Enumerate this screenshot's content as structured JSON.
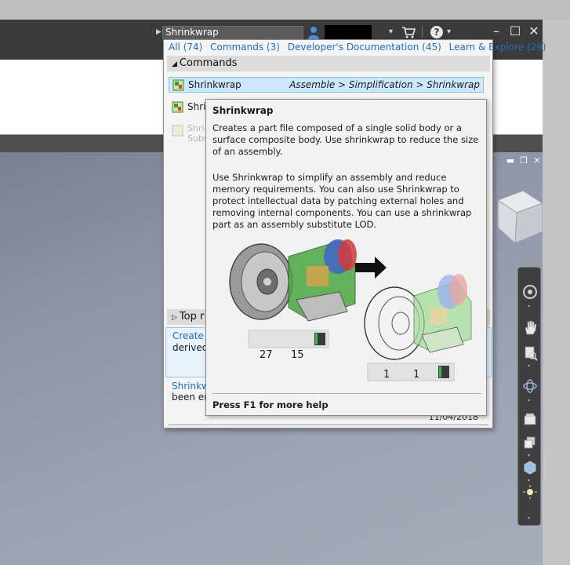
{
  "titlebar": {
    "search_value": "Shrinkwrap"
  },
  "search_panel": {
    "filters": [
      {
        "label": "All (74)"
      },
      {
        "label": "Commands (3)"
      },
      {
        "label": "Developer's Documentation (45)"
      },
      {
        "label": "Learn & Explore (29)"
      }
    ],
    "commands_header": "Commands",
    "commands": [
      {
        "label": "Shrinkwrap",
        "path": "Assemble > Simplification > Shrinkwrap",
        "selected": true
      },
      {
        "label": "Shri"
      },
      {
        "label": "Shri",
        "sub": "Subs"
      }
    ],
    "top_header": "Top r",
    "top_result_link": "Create a",
    "top_result_text": "derived s",
    "second_result_link": "Shrinkwr",
    "second_result_text": "been enl",
    "date": "11/04/2018"
  },
  "tooltip": {
    "title": "Shrinkwrap",
    "paragraph1": "Creates a part file composed of a single solid body or a surface composite body. Use shrinkwrap to reduce the size of an assembly.",
    "paragraph2": "Use Shrinkwrap to simplify an assembly and reduce memory requirements. You can also use Shrinkwrap to protect intellectual data by patching external holes and removing internal components. You can use a shrinkwrap part as an assembly substitute LOD.",
    "before_counts": [
      "27",
      "15"
    ],
    "after_counts": [
      "1",
      "1"
    ],
    "footer": "Press F1 for more help"
  },
  "colors": {
    "link": "#1f6dc4",
    "selection": "#cde8fb",
    "titlebar": "#3b3b3b"
  },
  "icons": [
    "user-icon",
    "cart-icon",
    "help-icon",
    "minimize-icon",
    "maximize-icon",
    "close-icon",
    "shrinkwrap-icon",
    "viewcube-icon",
    "pan-icon",
    "orbit-icon"
  ]
}
